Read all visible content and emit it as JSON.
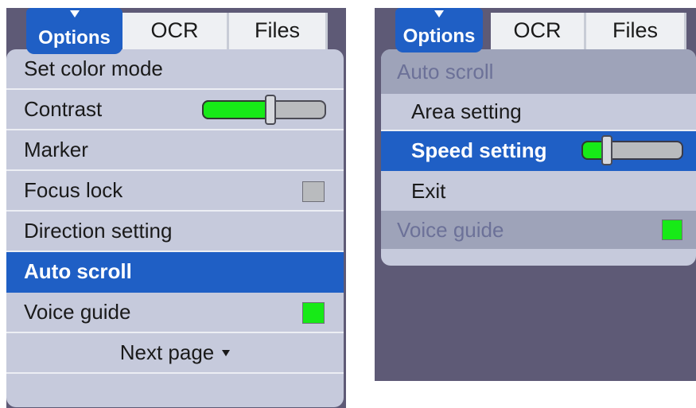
{
  "left_screen": {
    "tabs": {
      "active": "Options",
      "second": "OCR",
      "third": "Files"
    },
    "menu": [
      {
        "label": "Set color mode"
      },
      {
        "label": "Contrast",
        "slider_value_pct": 55
      },
      {
        "label": "Marker"
      },
      {
        "label": "Focus lock",
        "checked": false
      },
      {
        "label": "Direction setting"
      },
      {
        "label": "Auto scroll",
        "selected": true
      },
      {
        "label": "Voice guide",
        "checked": true
      },
      {
        "label": "Next page"
      }
    ]
  },
  "right_screen": {
    "tabs": {
      "active": "Options",
      "second": "OCR",
      "third": "Files"
    },
    "menu": {
      "header": "Auto scroll",
      "items": [
        {
          "label": "Area setting"
        },
        {
          "label": "Speed setting",
          "selected": true,
          "slider_value_pct": 25
        },
        {
          "label": "Exit"
        }
      ],
      "footer": {
        "label": "Voice guide",
        "checked": true
      }
    }
  },
  "colors": {
    "accent": "#1f5fc5",
    "menu_bg": "#c6cadc",
    "screen_bg": "#5e5a76",
    "checkbox_on": "#17ea17",
    "checkbox_off": "#b9bbbe"
  }
}
